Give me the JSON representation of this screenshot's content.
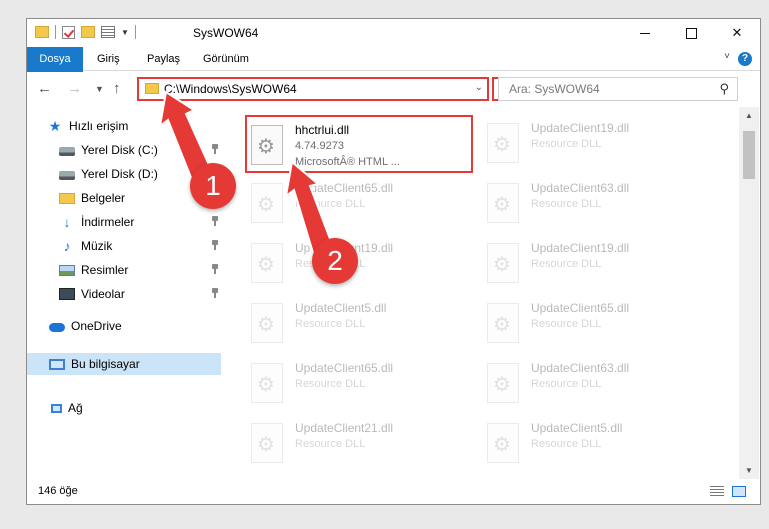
{
  "window": {
    "title": "SysWOW64"
  },
  "ribbon": {
    "tabs": [
      "Dosya",
      "Giriş",
      "Paylaş",
      "Görünüm"
    ],
    "help_label": "?"
  },
  "nav": {
    "address": "C:\\Windows\\SysWOW64",
    "search_placeholder": "Ara: SysWOW64"
  },
  "sidebar": {
    "items": [
      {
        "label": "Hızlı erişim",
        "icon": "star-icon"
      },
      {
        "label": "Yerel Disk (C:)",
        "icon": "drive-icon"
      },
      {
        "label": "Yerel Disk (D:)",
        "icon": "drive-icon"
      },
      {
        "label": "Belgeler",
        "icon": "documents-icon"
      },
      {
        "label": "İndirmeler",
        "icon": "download-icon"
      },
      {
        "label": "Müzik",
        "icon": "music-icon"
      },
      {
        "label": "Resimler",
        "icon": "pictures-icon"
      },
      {
        "label": "Videolar",
        "icon": "video-icon"
      },
      {
        "label": "OneDrive",
        "icon": "cloud-icon"
      },
      {
        "label": "Bu bilgisayar",
        "icon": "computer-icon"
      },
      {
        "label": "Ağ",
        "icon": "network-icon"
      }
    ]
  },
  "files": {
    "highlighted": {
      "name": "hhctrlui.dll",
      "version": "4.74.9273",
      "company": "MicrosoftÂ® HTML ..."
    },
    "items": [
      {
        "name": "UpdateClient19.dll",
        "desc": "Resource DLL"
      },
      {
        "name": "UpdateClient65.dll",
        "desc": "Resource DLL"
      },
      {
        "name": "UpdateClient63.dll",
        "desc": "Resource DLL"
      },
      {
        "name": "UpdateClient19.dll",
        "desc": "Resource DLL"
      },
      {
        "name": "UpdateClient19.dll",
        "desc": "Resource DLL"
      },
      {
        "name": "UpdateClient5.dll",
        "desc": "Resource DLL"
      },
      {
        "name": "UpdateClient65.dll",
        "desc": "Resource DLL"
      },
      {
        "name": "UpdateClient65.dll",
        "desc": "Resource DLL"
      },
      {
        "name": "UpdateClient63.dll",
        "desc": "Resource DLL"
      },
      {
        "name": "UpdateClient21.dll",
        "desc": "Resource DLL"
      },
      {
        "name": "UpdateClient5.dll",
        "desc": "Resource DLL"
      }
    ]
  },
  "status": {
    "count": "146 öğe"
  },
  "callouts": {
    "one": "1",
    "two": "2"
  },
  "colors": {
    "accent": "#1979ca",
    "highlight": "#e53935",
    "selection": "#cce4f7"
  }
}
